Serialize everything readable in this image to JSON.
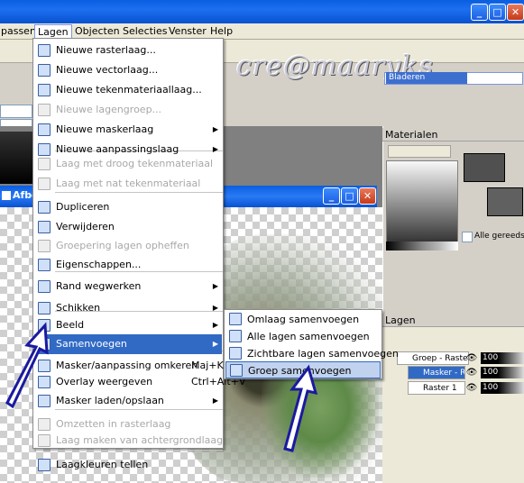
{
  "menubar": {
    "items": [
      "passen",
      "Lagen",
      "Objecten",
      "Selecties",
      "Venster",
      "Help"
    ]
  },
  "watermark": "cre@maaryks",
  "browser_title": "Bladeren",
  "afbeelding_title": "Afbee",
  "panels": {
    "materials_title": "Materialen",
    "all_tools_label": "Alle gereedscha",
    "layers_title": "Lagen"
  },
  "layers": [
    {
      "name": "Groep - Raster",
      "opacity": "100"
    },
    {
      "name": "Masker - Ra",
      "opacity": "100"
    },
    {
      "name": "Raster 1",
      "opacity": "100"
    }
  ],
  "lagen_menu": [
    {
      "label": "Nieuwe rasterlaag...",
      "enabled": true
    },
    {
      "label": "Nieuwe vectorlaag...",
      "enabled": true
    },
    {
      "label": "Nieuwe tekenmateriaallaag...",
      "enabled": true
    },
    {
      "label": "Nieuwe lagengroep...",
      "enabled": false
    },
    {
      "label": "Nieuwe maskerlaag",
      "enabled": true,
      "submenu": true
    },
    {
      "label": "Nieuwe aanpassingslaag",
      "enabled": true,
      "submenu": true
    },
    {
      "label": "Laag met droog tekenmateriaal",
      "enabled": false
    },
    {
      "label": "Laag met nat tekenmateriaal",
      "enabled": false
    },
    {
      "label": "Dupliceren",
      "enabled": true
    },
    {
      "label": "Verwijderen",
      "enabled": true
    },
    {
      "label": "Groepering lagen opheffen",
      "enabled": false
    },
    {
      "label": "Eigenschappen...",
      "enabled": true
    },
    {
      "label": "Rand wegwerken",
      "enabled": true,
      "submenu": true
    },
    {
      "label": "Schikken",
      "enabled": true,
      "submenu": true
    },
    {
      "label": "Beeld",
      "enabled": true,
      "submenu": true
    },
    {
      "label": "Samenvoegen",
      "enabled": true,
      "submenu": true,
      "highlighted": true
    },
    {
      "label": "Masker/aanpassing omkeren",
      "enabled": true,
      "shortcut": "Maj+K"
    },
    {
      "label": "Overlay weergeven",
      "enabled": true,
      "shortcut": "Ctrl+Alt+V"
    },
    {
      "label": "Masker laden/opslaan",
      "enabled": true,
      "submenu": true
    },
    {
      "label": "Omzetten in rasterlaag",
      "enabled": false
    },
    {
      "label": "Laag maken van achtergrondlaag",
      "enabled": false
    },
    {
      "label": "Laagkleuren tellen",
      "enabled": true
    }
  ],
  "samenvoegen_menu": [
    {
      "label": "Omlaag samenvoegen"
    },
    {
      "label": "Alle lagen samenvoegen"
    },
    {
      "label": "Zichtbare lagen samenvoegen"
    },
    {
      "label": "Groep samenvoegen",
      "highlighted": true
    }
  ]
}
